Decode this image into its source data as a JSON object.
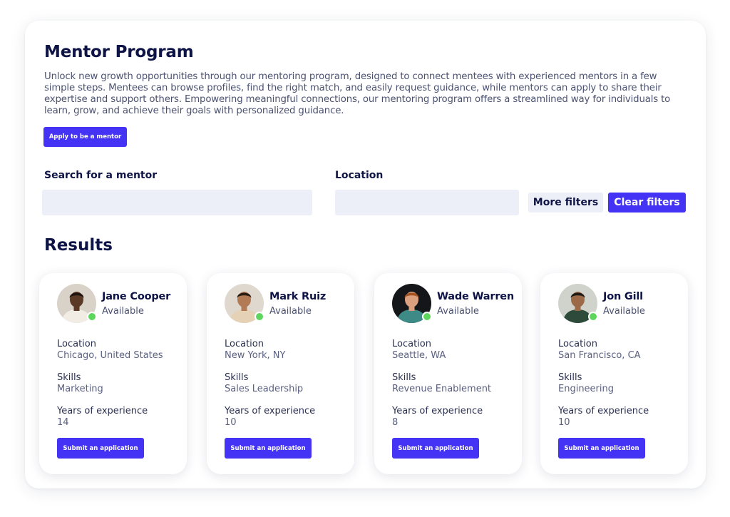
{
  "page": {
    "title": "Mentor Program",
    "description": "Unlock new growth opportunities through our mentoring program, designed to connect mentees with experienced mentors in a few simple steps. Mentees can browse profiles, find the right match, and easily request guidance, while mentors can apply to share their expertise and support others. Empowering meaningful connections, our mentoring program offers a streamlined way for individuals to learn, grow, and achieve their goals with personalized guidance.",
    "apply_label": "Apply to be a mentor"
  },
  "search": {
    "mentor_label": "Search for a mentor",
    "mentor_value": "",
    "location_label": "Location",
    "location_value": "",
    "more_filters": "More filters",
    "clear_filters": "Clear filters"
  },
  "results": {
    "title": "Results",
    "field_labels": {
      "location": "Location",
      "skills": "Skills",
      "experience": "Years of experience"
    },
    "submit_label": "Submit an application",
    "mentors": [
      {
        "name": "Jane Cooper",
        "status": "Available",
        "location": "Chicago, United States",
        "skills": "Marketing",
        "years": "14",
        "avatar": "avatar-photo",
        "bg": "#d9d2c8",
        "shirt": "#f2ede4",
        "skin": "#5a3a26",
        "hair": "#1e1410"
      },
      {
        "name": "Mark Ruiz",
        "status": "Available",
        "location": "New York, NY",
        "skills": "Sales Leadership",
        "years": "10",
        "avatar": "avatar-photo",
        "bg": "#ded8cf",
        "shirt": "#e5d2b6",
        "skin": "#b27a55",
        "hair": "#2b1d14"
      },
      {
        "name": "Wade Warren",
        "status": "Available",
        "location": "Seattle, WA",
        "skills": "Revenue Enablement",
        "years": "8",
        "avatar": "avatar-photo",
        "bg": "#14161a",
        "shirt": "#3e8a86",
        "skin": "#dba07e",
        "hair": "#a4521f"
      },
      {
        "name": "Jon Gill",
        "status": "Available",
        "location": "San Francisco, CA",
        "skills": "Engineering",
        "years": "10",
        "avatar": "avatar-photo",
        "bg": "#cfd3cc",
        "shirt": "#2d4a3b",
        "skin": "#9c6a48",
        "hair": "#1e1a17"
      }
    ]
  },
  "colors": {
    "accent": "#4433f5",
    "heading": "#0f1446",
    "input_bg": "#eceff7",
    "online": "#5cd65c"
  }
}
